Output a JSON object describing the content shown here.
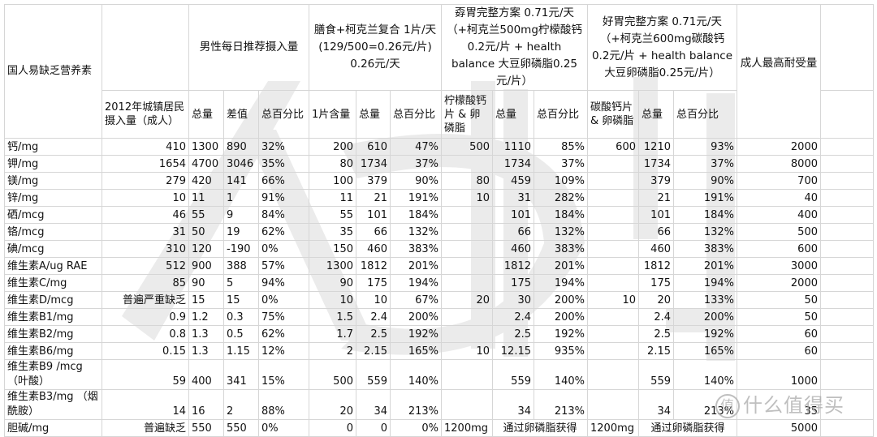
{
  "header": {
    "nutrient_col": "国人易缺乏营养素",
    "male_rec_group": "男性每日推荐摄入量",
    "urban_intake": "2012年城镇居民摄入量（成人）",
    "total": "总量",
    "diff": "差值",
    "pct": "总百分比",
    "plan1_title": "膳食+柯克兰复合 1片/天 (129/500=0.26元/片) 0.26元/天",
    "plan1_per_tablet": "1片含量",
    "plan2_title": "孬胃完整方案 0.71元/天 （+柯克兰500mg柠檬酸钙 0.2元/片 + health balance 大豆卵磷脂0.25元/片）",
    "plan2_supp": "柠檬酸钙片 & 卵磷脂",
    "plan3_title": "好胃完整方案 0.71元/天 （+柯克兰600mg碳酸钙 0.2元/片 + health balance 大豆卵磷脂0.25元/片）",
    "plan3_supp": "碳酸钙片 & 卵磷脂",
    "ul_col": "成人最高耐受量"
  },
  "rows": [
    {
      "name": "钙/mg",
      "urban": "410",
      "total": "1300",
      "diff": "890",
      "pct": "32%",
      "p1_tab": "200",
      "p1_total": "610",
      "p1_pct": "47%",
      "p2_supp": "500",
      "p2_total": "1110",
      "p2_pct": "85%",
      "p3_supp": "600",
      "p3_total": "1210",
      "p3_pct": "93%",
      "ul": "2000"
    },
    {
      "name": "钾/mg",
      "urban": "1654",
      "total": "4700",
      "diff": "3046",
      "pct": "35%",
      "p1_tab": "80",
      "p1_total": "1734",
      "p1_pct": "37%",
      "p2_supp": "",
      "p2_total": "1734",
      "p2_pct": "37%",
      "p3_supp": "",
      "p3_total": "1734",
      "p3_pct": "37%",
      "ul": "8000"
    },
    {
      "name": "镁/mg",
      "urban": "279",
      "total": "420",
      "diff": "141",
      "pct": "66%",
      "p1_tab": "100",
      "p1_total": "379",
      "p1_pct": "90%",
      "p2_supp": "80",
      "p2_total": "459",
      "p2_pct": "109%",
      "p3_supp": "",
      "p3_total": "379",
      "p3_pct": "90%",
      "ul": "700"
    },
    {
      "name": "锌/mg",
      "urban": "10",
      "total": "11",
      "diff": "1",
      "pct": "91%",
      "p1_tab": "11",
      "p1_total": "21",
      "p1_pct": "191%",
      "p2_supp": "10",
      "p2_total": "31",
      "p2_pct": "282%",
      "p3_supp": "",
      "p3_total": "21",
      "p3_pct": "191%",
      "ul": "40"
    },
    {
      "name": "硒/mcg",
      "urban": "46",
      "total": "55",
      "diff": "9",
      "pct": "84%",
      "p1_tab": "55",
      "p1_total": "101",
      "p1_pct": "184%",
      "p2_supp": "",
      "p2_total": "101",
      "p2_pct": "184%",
      "p3_supp": "",
      "p3_total": "101",
      "p3_pct": "184%",
      "ul": "400"
    },
    {
      "name": "铬/mcg",
      "urban": "31",
      "total": "50",
      "diff": "19",
      "pct": "62%",
      "p1_tab": "35",
      "p1_total": "66",
      "p1_pct": "132%",
      "p2_supp": "",
      "p2_total": "66",
      "p2_pct": "132%",
      "p3_supp": "",
      "p3_total": "66",
      "p3_pct": "132%",
      "ul": "500"
    },
    {
      "name": "碘/mcg",
      "urban": "310",
      "total": "120",
      "diff": "-190",
      "pct": "0%",
      "p1_tab": "150",
      "p1_total": "460",
      "p1_pct": "383%",
      "p2_supp": "",
      "p2_total": "460",
      "p2_pct": "383%",
      "p3_supp": "",
      "p3_total": "460",
      "p3_pct": "383%",
      "ul": "600"
    },
    {
      "name": "维生素A/ug RAE",
      "urban": "512",
      "total": "900",
      "diff": "388",
      "pct": "57%",
      "p1_tab": "1300",
      "p1_total": "1812",
      "p1_pct": "201%",
      "p2_supp": "",
      "p2_total": "1812",
      "p2_pct": "201%",
      "p3_supp": "",
      "p3_total": "1812",
      "p3_pct": "201%",
      "ul": "3000"
    },
    {
      "name": "维生素C/mg",
      "urban": "85",
      "total": "90",
      "diff": "5",
      "pct": "94%",
      "p1_tab": "90",
      "p1_total": "175",
      "p1_pct": "194%",
      "p2_supp": "",
      "p2_total": "175",
      "p2_pct": "194%",
      "p3_supp": "",
      "p3_total": "175",
      "p3_pct": "194%",
      "ul": "2000"
    },
    {
      "name": "维生素D/mcg",
      "urban": "普遍严重缺乏",
      "total": "15",
      "diff": "15",
      "pct": "0%",
      "p1_tab": "10",
      "p1_total": "10",
      "p1_pct": "67%",
      "p2_supp": "20",
      "p2_total": "30",
      "p2_pct": "200%",
      "p3_supp": "10",
      "p3_total": "20",
      "p3_pct": "133%",
      "ul": "50"
    },
    {
      "name": "维生素B1/mg",
      "urban": "0.9",
      "total": "1.2",
      "diff": "0.3",
      "pct": "75%",
      "p1_tab": "1.5",
      "p1_total": "2.4",
      "p1_pct": "200%",
      "p2_supp": "",
      "p2_total": "2.4",
      "p2_pct": "200%",
      "p3_supp": "",
      "p3_total": "2.4",
      "p3_pct": "200%",
      "ul": "50"
    },
    {
      "name": "维生素B2/mg",
      "urban": "0.8",
      "total": "1.3",
      "diff": "0.5",
      "pct": "62%",
      "p1_tab": "1.7",
      "p1_total": "2.5",
      "p1_pct": "192%",
      "p2_supp": "",
      "p2_total": "2.5",
      "p2_pct": "192%",
      "p3_supp": "",
      "p3_total": "2.5",
      "p3_pct": "192%",
      "ul": "60"
    },
    {
      "name": "维生素B6/mg",
      "urban": "0.15",
      "total": "1.3",
      "diff": "1.15",
      "pct": "12%",
      "p1_tab": "2",
      "p1_total": "2.15",
      "p1_pct": "165%",
      "p2_supp": "10",
      "p2_total": "12.15",
      "p2_pct": "935%",
      "p3_supp": "",
      "p3_total": "2.15",
      "p3_pct": "165%",
      "ul": "60"
    },
    {
      "name": "维生素B9 /mcg （叶酸）",
      "urban": "59",
      "total": "400",
      "diff": "341",
      "pct": "15%",
      "p1_tab": "500",
      "p1_total": "559",
      "p1_pct": "140%",
      "p2_supp": "",
      "p2_total": "559",
      "p2_pct": "140%",
      "p3_supp": "",
      "p3_total": "559",
      "p3_pct": "140%",
      "ul": "1000",
      "tall": true
    },
    {
      "name": "维生素B3/mg （烟酰胺）",
      "urban": "14",
      "total": "16",
      "diff": "2",
      "pct": "88%",
      "p1_tab": "20",
      "p1_total": "34",
      "p1_pct": "213%",
      "p2_supp": "",
      "p2_total": "34",
      "p2_pct": "213%",
      "p3_supp": "",
      "p3_total": "34",
      "p3_pct": "213%",
      "ul": "35",
      "tall": true
    },
    {
      "name": "胆碱/mg",
      "urban": "普遍缺乏",
      "total": "550",
      "diff": "550",
      "pct": "0%",
      "p1_tab": "0",
      "p1_total": "0",
      "p1_pct": "0%",
      "p2_supp": "1200mg",
      "p2_total": "通过卵磷脂获得",
      "p2_pct": "",
      "p3_supp": "1200mg",
      "p3_total": "通过卵磷脂获得",
      "p3_pct": "",
      "ul": "5000",
      "merged": true
    }
  ],
  "watermark": {
    "logo_glyph": "值",
    "logo_text": "什么值得买",
    "logo_icon": "smzdm-logo-icon"
  }
}
